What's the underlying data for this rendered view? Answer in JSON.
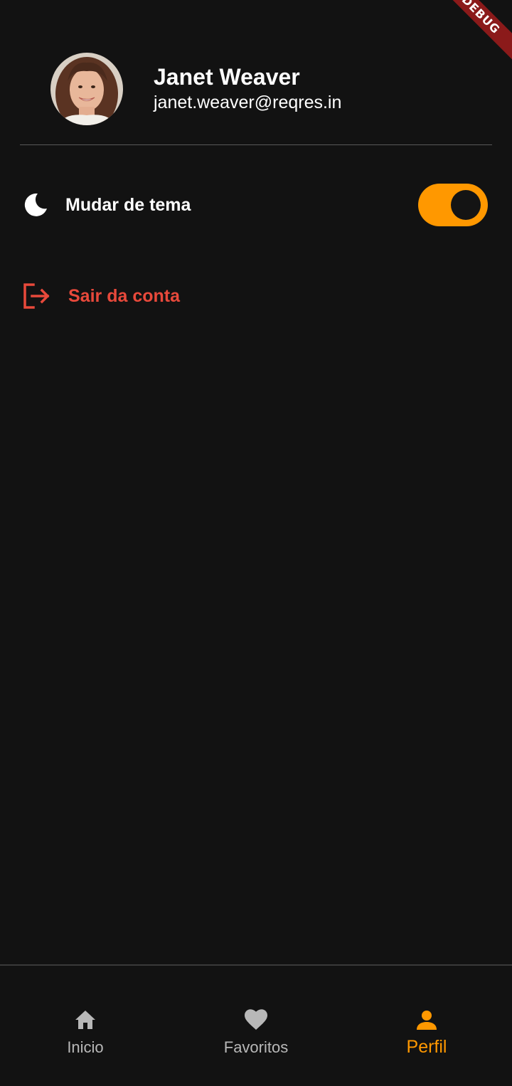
{
  "debug_banner": "DEBUG",
  "profile": {
    "name": "Janet Weaver",
    "email": "janet.weaver@reqres.in",
    "avatar_icon": "avatar-photo"
  },
  "settings": {
    "theme": {
      "icon": "moon-icon",
      "label": "Mudar de tema",
      "toggle_on": true
    },
    "logout": {
      "icon": "logout-icon",
      "label": "Sair da conta"
    }
  },
  "bottom_nav": {
    "items": [
      {
        "label": "Inicio",
        "icon": "home-icon",
        "active": false
      },
      {
        "label": "Favoritos",
        "icon": "heart-icon",
        "active": false
      },
      {
        "label": "Perfil",
        "icon": "person-icon",
        "active": true
      }
    ]
  },
  "colors": {
    "background": "#121212",
    "accent": "#ff9800",
    "danger": "#e8493b",
    "debug_ribbon": "#8b1a1a"
  }
}
